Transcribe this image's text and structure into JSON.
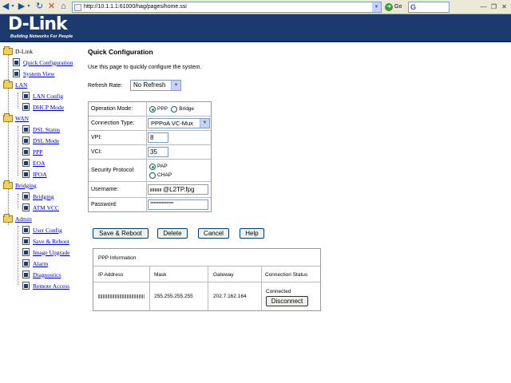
{
  "browser": {
    "address": "http://10.1.1.1:61000/hag/pages/home.ssi",
    "go_label": "Go",
    "search_logo": "G"
  },
  "banner": {
    "logo": "D-Link",
    "tagline": "Building Networks For People",
    "color": "#1b3b6f"
  },
  "sidebar": {
    "root": "D-Link",
    "quick_config": "Quick Configuration",
    "system_view": "System View",
    "lan": "LAN",
    "lan_config": "LAN Config",
    "dhcp_mode": "DHCP Mode",
    "wan": "WAN",
    "dsl_status": "DSL Status",
    "dsl_mode": "DSL Mode",
    "ppp": "PPP",
    "eoa": "EOA",
    "ipoa": "IPOA",
    "bridging_folder": "Bridging",
    "bridging": "Bridging",
    "atm_vcc": "ATM VCC",
    "admin": "Admin",
    "user_config": "User Config",
    "save_reboot": "Save & Reboot",
    "image_upgrade": "Image Upgrade",
    "alarm": "Alarm",
    "diagnostics": "Diagnostics",
    "remote_access": "Remote Access"
  },
  "main": {
    "title": "Quick Configuration",
    "description": "Use this page to quickly configure the system.",
    "refresh_label": "Refresh Rate:",
    "refresh_value": "No Refresh"
  },
  "form": {
    "operation_mode_label": "Operation Mode:",
    "mode_ppp": "PPP",
    "mode_bridge": "Bridge",
    "connection_type_label": "Connection Type:",
    "connection_type_value": "PPPoA VC-Mux",
    "vpi_label": "VPI:",
    "vpi_value": "8",
    "vci_label": "VCI:",
    "vci_value": "35",
    "security_label": "Security Protocol:",
    "sec_pap": "PAP",
    "sec_chap": "CHAP",
    "username_label": "Username:",
    "username_value": "@L2TP.fpg",
    "password_label": "Password:",
    "password_value": "********************"
  },
  "buttons": {
    "save_reboot": "Save & Reboot",
    "delete": "Delete",
    "cancel": "Cancel",
    "help": "Help"
  },
  "ppp_info": {
    "title": "PPP Information",
    "headers": [
      "IP Address",
      "Mask",
      "Gateway",
      "Connection Status"
    ],
    "mask": "255.255.255.255",
    "gateway": "202.7.162.164",
    "status": "Connected",
    "disconnect_label": "Disconnect"
  }
}
